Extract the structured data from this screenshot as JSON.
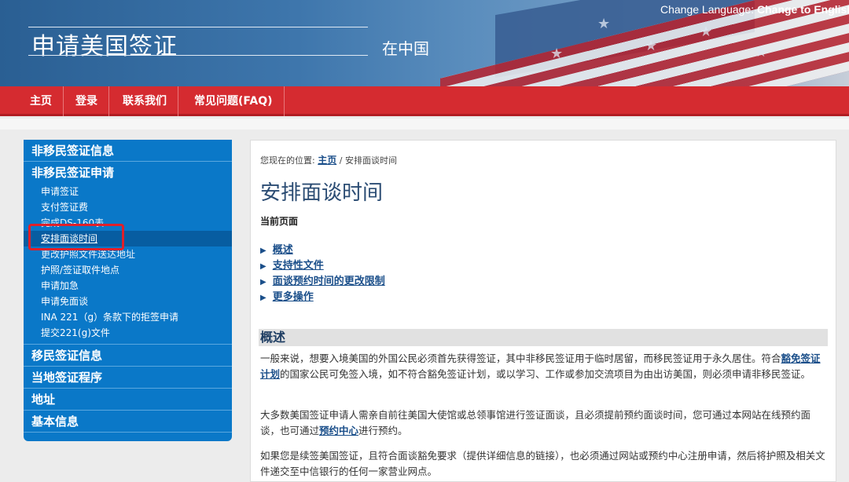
{
  "header": {
    "title": "申请美国签证",
    "subtitle": "在中国",
    "language_label": "Change Language:",
    "language_link": "Change to English"
  },
  "nav": {
    "items": [
      "主页",
      "登录",
      "联系我们",
      "常见问题(FAQ)"
    ]
  },
  "sidebar": {
    "section1": "非移民签证信息",
    "section2": "非移民签证申请",
    "sub_items": [
      "申请签证",
      "支付签证费",
      "完成DS-160表",
      "安排面谈时间",
      "更改护照文件送达地址",
      "护照/签证取件地点",
      "申请加急",
      "申请免面谈",
      "INA 221（g）条款下的拒签申请",
      "提交221(g)文件"
    ],
    "section3": "移民签证信息",
    "section4": "当地签证程序",
    "section5": "地址",
    "section6": "基本信息"
  },
  "main": {
    "breadcrumb_prefix": "您现在的位置:",
    "breadcrumb_home": "主页",
    "breadcrumb_sep": "/",
    "breadcrumb_current": "安排面谈时间",
    "title": "安排面谈时间",
    "current_page_label": "当前页面",
    "toc": [
      "概述",
      "支持性文件",
      "面谈预约时间的更改限制",
      "更多操作"
    ],
    "section_title": "概述",
    "p1_a": "一般来说，想要入境美国的外国公民必须首先获得签证，其中非移民签证用于临时居留，而移民签证用于永久居住。符合",
    "p1_link": "豁免签证计划",
    "p1_b": "的国家公民可免签入境，如不符合豁免签证计划，或以学习、工作或参加交流项目为由出访美国，则必须申请非移民签证。",
    "p2_a": "大多数美国签证申请人需亲自前往美国大使馆或总领事馆进行签证面谈，且必须提前预约面谈时间，您可通过本网站在线预约面谈，也可通过",
    "p2_link": "预约中心",
    "p2_b": "进行预约。",
    "p3": "如果您是续签美国签证，且符合面谈豁免要求（提供详细信息的链接），也必须通过网站或预约中心注册申请，然后将护照及相关文件递交至中信银行的任何一家营业网点。"
  },
  "colors": {
    "nav_red": "#d52b30",
    "sidebar_blue": "#0a78c8",
    "highlight_red": "#e0202a",
    "title_blue": "#2b4c73"
  }
}
